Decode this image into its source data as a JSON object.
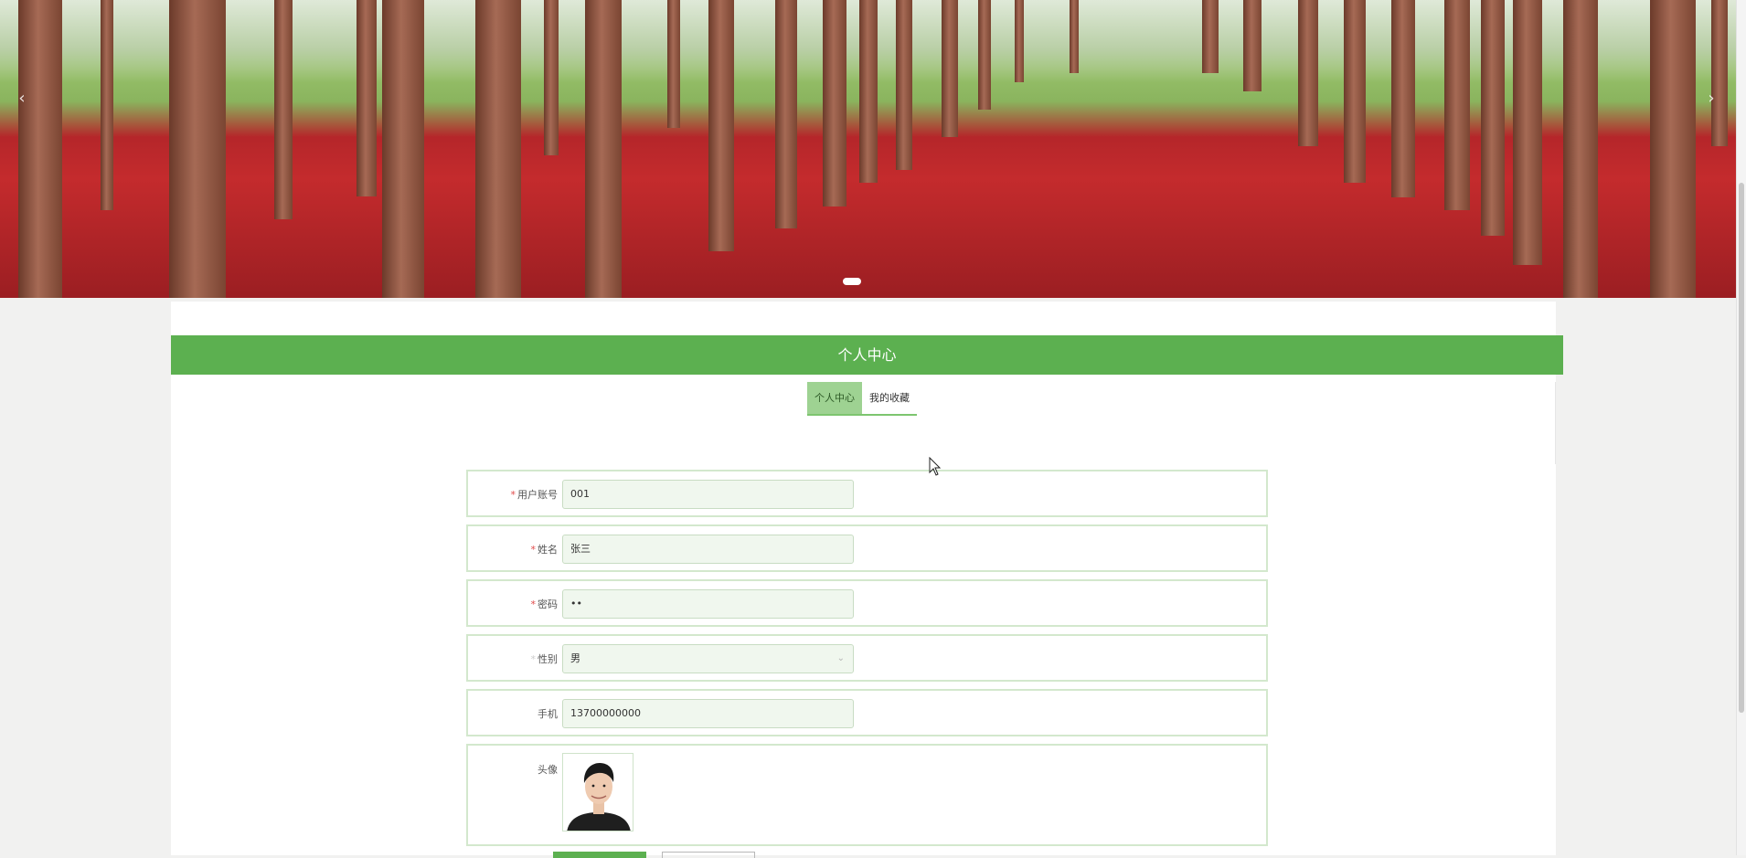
{
  "banner": {
    "prev_label": "‹",
    "next_label": "›"
  },
  "header": {
    "title": "个人中心"
  },
  "tabs": [
    {
      "label": "个人中心"
    },
    {
      "label": "我的收藏"
    }
  ],
  "form": {
    "account": {
      "label": "用户账号",
      "value": "001"
    },
    "name": {
      "label": "姓名",
      "value": "张三"
    },
    "password": {
      "label": "密码",
      "value": "••"
    },
    "gender": {
      "label": "性别",
      "value": "男"
    },
    "phone": {
      "label": "手机",
      "value": "13700000000"
    },
    "avatar": {
      "label": "头像"
    }
  },
  "colors": {
    "accent": "#5cb050",
    "tab_active": "#9ed292",
    "input_bg": "#f0f7ee"
  }
}
